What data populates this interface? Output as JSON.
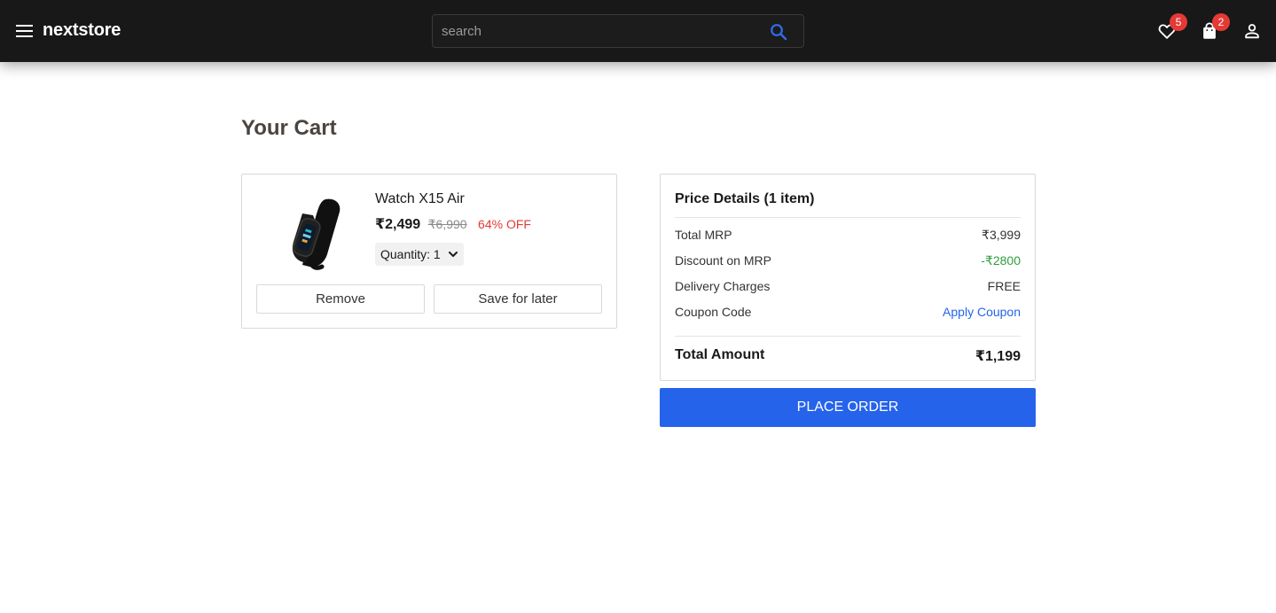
{
  "header": {
    "brand": "nextstore",
    "search_placeholder": "search",
    "wishlist_count": "5",
    "cart_count": "2",
    "icons": [
      "menu-icon",
      "search-icon",
      "heart-icon",
      "shopping-bag-icon",
      "user-icon"
    ]
  },
  "page": {
    "title": "Your Cart"
  },
  "cart_items": [
    {
      "name": "Watch X15 Air",
      "price": "₹2,499",
      "mrp": "₹6,990",
      "discount": "64% OFF",
      "quantity_label": "Quantity:",
      "quantity": "1",
      "remove_label": "Remove",
      "save_label": "Save for later"
    }
  ],
  "summary": {
    "title": "Price Details (1 item)",
    "rows": [
      {
        "label": "Total MRP",
        "value": "₹3,999"
      },
      {
        "label": "Discount on MRP",
        "value": "-₹2800"
      },
      {
        "label": "Delivery Charges",
        "value": "FREE"
      },
      {
        "label": "Coupon Code",
        "value": "Apply Coupon"
      }
    ],
    "total_label": "Total Amount",
    "total_value": "₹1,199",
    "place_order_label": "PLACE ORDER"
  },
  "colors": {
    "header_bg": "#181818",
    "accent": "#2563eb",
    "discount_red": "#e53935",
    "success_green": "#2e9e3e",
    "badge_red": "#e53935"
  }
}
